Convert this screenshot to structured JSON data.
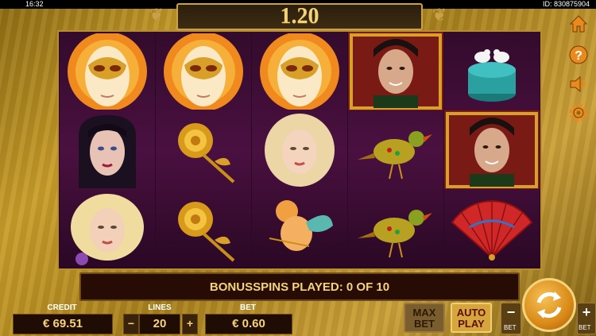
{
  "status_bar": {
    "time": "16:32",
    "game_id": "ID: 830875904"
  },
  "win_display": {
    "value": "1.20"
  },
  "reels": [
    [
      "Venetian mask",
      "Dark-haired woman",
      "Blonde woman with flower"
    ],
    [
      "Venetian mask",
      "Golden rose",
      "Golden rose"
    ],
    [
      "Venetian mask",
      "Blonde woman",
      "Cupid"
    ],
    [
      "Man portrait (gold frame)",
      "Jeweled bird",
      "Jeweled bird"
    ],
    [
      "Doves jewelry box",
      "Man portrait (gold frame)",
      "Red fan"
    ]
  ],
  "message": "BONUSSPINS PLAYED: 0 OF 10",
  "credit": {
    "label": "CREDIT",
    "value": "€ 69.51"
  },
  "lines": {
    "label": "LINES",
    "value": "20",
    "minus": "−",
    "plus": "+"
  },
  "bet": {
    "label": "BET",
    "value": "€ 0.60"
  },
  "buttons": {
    "max_bet": [
      "MAX",
      "BET"
    ],
    "auto_play": [
      "AUTO",
      "PLAY"
    ],
    "bet_minus": "−",
    "bet_plus": "+",
    "bet_minus_label": "BET",
    "bet_plus_label": "BET"
  },
  "side_icons": [
    "home-icon",
    "help-icon",
    "sound-icon",
    "settings-icon"
  ],
  "colors": {
    "gold": "#f4d37a",
    "panel": "#270c06",
    "reel_bg": "#4a1040",
    "orange": "#e88a1e"
  }
}
